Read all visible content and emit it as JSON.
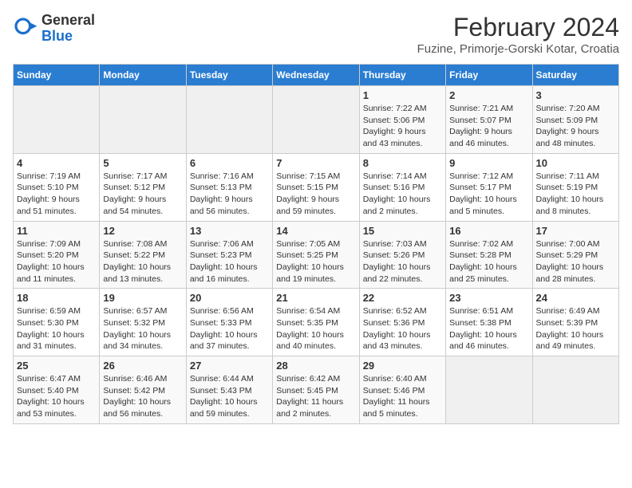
{
  "header": {
    "logo_general": "General",
    "logo_blue": "Blue",
    "month_title": "February 2024",
    "location": "Fuzine, Primorje-Gorski Kotar, Croatia"
  },
  "weekdays": [
    "Sunday",
    "Monday",
    "Tuesday",
    "Wednesday",
    "Thursday",
    "Friday",
    "Saturday"
  ],
  "weeks": [
    [
      {
        "day": "",
        "info": ""
      },
      {
        "day": "",
        "info": ""
      },
      {
        "day": "",
        "info": ""
      },
      {
        "day": "",
        "info": ""
      },
      {
        "day": "1",
        "info": "Sunrise: 7:22 AM\nSunset: 5:06 PM\nDaylight: 9 hours\nand 43 minutes."
      },
      {
        "day": "2",
        "info": "Sunrise: 7:21 AM\nSunset: 5:07 PM\nDaylight: 9 hours\nand 46 minutes."
      },
      {
        "day": "3",
        "info": "Sunrise: 7:20 AM\nSunset: 5:09 PM\nDaylight: 9 hours\nand 48 minutes."
      }
    ],
    [
      {
        "day": "4",
        "info": "Sunrise: 7:19 AM\nSunset: 5:10 PM\nDaylight: 9 hours\nand 51 minutes."
      },
      {
        "day": "5",
        "info": "Sunrise: 7:17 AM\nSunset: 5:12 PM\nDaylight: 9 hours\nand 54 minutes."
      },
      {
        "day": "6",
        "info": "Sunrise: 7:16 AM\nSunset: 5:13 PM\nDaylight: 9 hours\nand 56 minutes."
      },
      {
        "day": "7",
        "info": "Sunrise: 7:15 AM\nSunset: 5:15 PM\nDaylight: 9 hours\nand 59 minutes."
      },
      {
        "day": "8",
        "info": "Sunrise: 7:14 AM\nSunset: 5:16 PM\nDaylight: 10 hours\nand 2 minutes."
      },
      {
        "day": "9",
        "info": "Sunrise: 7:12 AM\nSunset: 5:17 PM\nDaylight: 10 hours\nand 5 minutes."
      },
      {
        "day": "10",
        "info": "Sunrise: 7:11 AM\nSunset: 5:19 PM\nDaylight: 10 hours\nand 8 minutes."
      }
    ],
    [
      {
        "day": "11",
        "info": "Sunrise: 7:09 AM\nSunset: 5:20 PM\nDaylight: 10 hours\nand 11 minutes."
      },
      {
        "day": "12",
        "info": "Sunrise: 7:08 AM\nSunset: 5:22 PM\nDaylight: 10 hours\nand 13 minutes."
      },
      {
        "day": "13",
        "info": "Sunrise: 7:06 AM\nSunset: 5:23 PM\nDaylight: 10 hours\nand 16 minutes."
      },
      {
        "day": "14",
        "info": "Sunrise: 7:05 AM\nSunset: 5:25 PM\nDaylight: 10 hours\nand 19 minutes."
      },
      {
        "day": "15",
        "info": "Sunrise: 7:03 AM\nSunset: 5:26 PM\nDaylight: 10 hours\nand 22 minutes."
      },
      {
        "day": "16",
        "info": "Sunrise: 7:02 AM\nSunset: 5:28 PM\nDaylight: 10 hours\nand 25 minutes."
      },
      {
        "day": "17",
        "info": "Sunrise: 7:00 AM\nSunset: 5:29 PM\nDaylight: 10 hours\nand 28 minutes."
      }
    ],
    [
      {
        "day": "18",
        "info": "Sunrise: 6:59 AM\nSunset: 5:30 PM\nDaylight: 10 hours\nand 31 minutes."
      },
      {
        "day": "19",
        "info": "Sunrise: 6:57 AM\nSunset: 5:32 PM\nDaylight: 10 hours\nand 34 minutes."
      },
      {
        "day": "20",
        "info": "Sunrise: 6:56 AM\nSunset: 5:33 PM\nDaylight: 10 hours\nand 37 minutes."
      },
      {
        "day": "21",
        "info": "Sunrise: 6:54 AM\nSunset: 5:35 PM\nDaylight: 10 hours\nand 40 minutes."
      },
      {
        "day": "22",
        "info": "Sunrise: 6:52 AM\nSunset: 5:36 PM\nDaylight: 10 hours\nand 43 minutes."
      },
      {
        "day": "23",
        "info": "Sunrise: 6:51 AM\nSunset: 5:38 PM\nDaylight: 10 hours\nand 46 minutes."
      },
      {
        "day": "24",
        "info": "Sunrise: 6:49 AM\nSunset: 5:39 PM\nDaylight: 10 hours\nand 49 minutes."
      }
    ],
    [
      {
        "day": "25",
        "info": "Sunrise: 6:47 AM\nSunset: 5:40 PM\nDaylight: 10 hours\nand 53 minutes."
      },
      {
        "day": "26",
        "info": "Sunrise: 6:46 AM\nSunset: 5:42 PM\nDaylight: 10 hours\nand 56 minutes."
      },
      {
        "day": "27",
        "info": "Sunrise: 6:44 AM\nSunset: 5:43 PM\nDaylight: 10 hours\nand 59 minutes."
      },
      {
        "day": "28",
        "info": "Sunrise: 6:42 AM\nSunset: 5:45 PM\nDaylight: 11 hours\nand 2 minutes."
      },
      {
        "day": "29",
        "info": "Sunrise: 6:40 AM\nSunset: 5:46 PM\nDaylight: 11 hours\nand 5 minutes."
      },
      {
        "day": "",
        "info": ""
      },
      {
        "day": "",
        "info": ""
      }
    ]
  ]
}
